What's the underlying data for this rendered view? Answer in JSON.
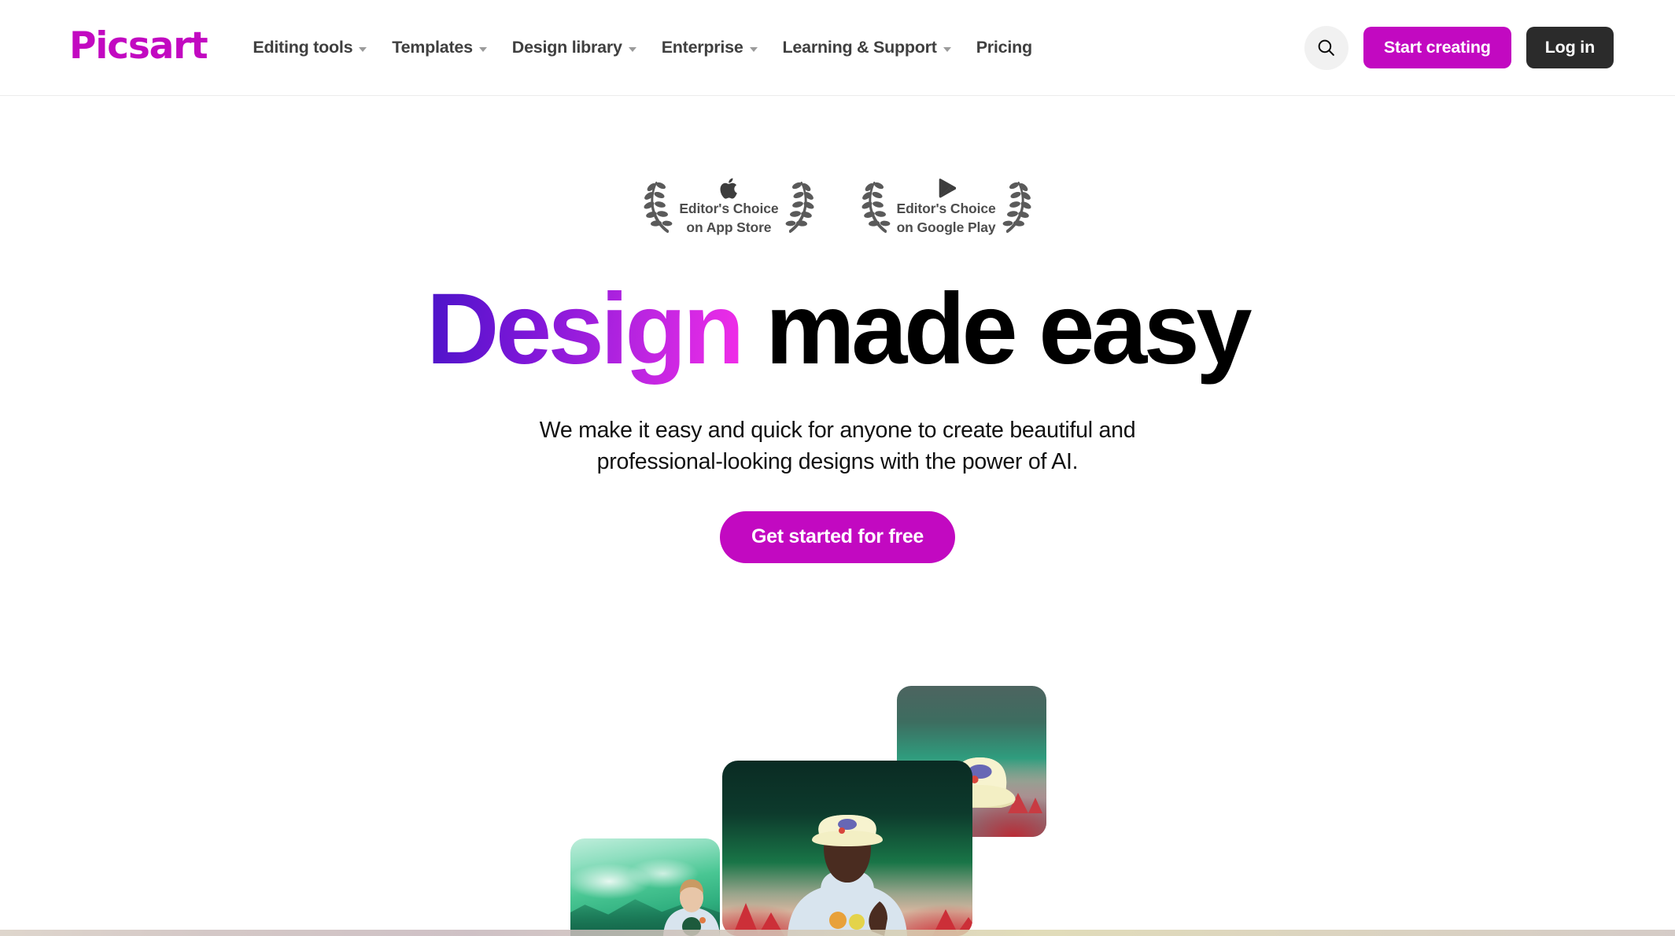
{
  "brand": {
    "name": "Picsart",
    "accent_color": "#c209c1",
    "logo_color": "#c209c1"
  },
  "header": {
    "nav": [
      {
        "label": "Editing tools",
        "has_dropdown": true,
        "icon": "chevron-down-icon"
      },
      {
        "label": "Templates",
        "has_dropdown": true,
        "icon": "chevron-down-icon"
      },
      {
        "label": "Design library",
        "has_dropdown": true,
        "icon": "chevron-down-icon"
      },
      {
        "label": "Enterprise",
        "has_dropdown": true,
        "icon": "chevron-down-icon"
      },
      {
        "label": "Learning & Support",
        "has_dropdown": true,
        "icon": "chevron-down-icon"
      },
      {
        "label": "Pricing",
        "has_dropdown": false,
        "icon": null
      }
    ],
    "search_icon": "search-icon",
    "start_creating_label": "Start creating",
    "start_creating_color": "#c209c1",
    "login_label": "Log in",
    "login_color": "#2b2b2b"
  },
  "hero": {
    "awards": [
      {
        "glyph": "apple-icon",
        "line1": "Editor's Choice",
        "line2": "on App Store"
      },
      {
        "glyph": "google-play-icon",
        "line1": "Editor's Choice",
        "line2": "on Google Play"
      }
    ],
    "title_gradient_word": "Design",
    "title_rest": " made easy",
    "title_gradient_from": "#4a14c8",
    "title_gradient_to": "#f22de8",
    "subtitle_line1": "We make it easy and quick for anyone to create beautiful and",
    "subtitle_line2": "professional-looking designs with the power of AI.",
    "cta_label": "Get started for free",
    "cta_color": "#c209c1"
  },
  "showcase": {
    "cards": [
      {
        "name": "card-woman-green-mountains",
        "alt": "Woman in light hoodie in front of green misty mountains"
      },
      {
        "name": "card-man-bucket-hat",
        "alt": "Man in bucket hat and light hoodie on dark green gradient with red peaks"
      },
      {
        "name": "card-bucket-hat-product",
        "alt": "Cream bucket hat product shot over teal sky and red mountains"
      }
    ]
  }
}
